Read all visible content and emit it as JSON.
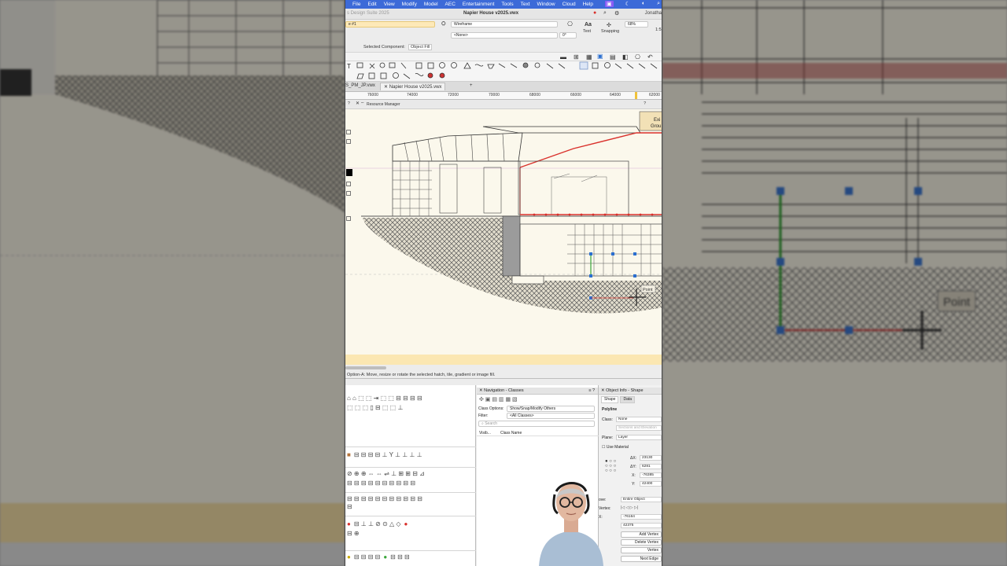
{
  "menubar": {
    "items": [
      "File",
      "Edit",
      "View",
      "Modify",
      "Model",
      "AEC",
      "Entertainment",
      "Tools",
      "Text",
      "Window",
      "Cloud",
      "Help"
    ]
  },
  "titlebar": {
    "app_name": "s Design Suite 2025",
    "document_title": "Napier House v2025.vwx",
    "user": "Jonatha"
  },
  "viewbar": {
    "layer_field": "e #1",
    "render_mode": "Wireframe",
    "class_none": "<None>",
    "rotation": "0°",
    "selected_component_label": "Selected Component:",
    "selected_component_value": "Object Fill",
    "text_label": "Text",
    "snapping_label": "Snapping",
    "zoom": "68%",
    "scale": "1:5"
  },
  "doc_tabs": {
    "tabs": [
      "S_PM_JP.vwx",
      "Napier House v2025.vwx"
    ],
    "add": "+"
  },
  "ruler": {
    "ticks": [
      "76000",
      "74000",
      "72000",
      "70000",
      "68000",
      "66000",
      "64000",
      "62000"
    ]
  },
  "resource_manager": {
    "title": "Resource Manager",
    "help": "?"
  },
  "canvas": {
    "tag_line1": "Exi",
    "tag_line2": "Grou",
    "cursor_tip": "Point"
  },
  "statusbar": {
    "text": "Option-A: Move, resize or rotate the selected hatch, tile, gradient or image fill."
  },
  "navigation": {
    "title": "Navigation - Classes",
    "class_options_label": "Class Options:",
    "class_options_value": "Show/Snap/Modify Others",
    "filter_label": "Filter:",
    "filter_value": "<All Classes>",
    "search_placeholder": "Search",
    "col_visibility": "Visib...",
    "col_class_name": "Class Name"
  },
  "object_info": {
    "title": "Object Info - Shape",
    "tab_shape": "Shape",
    "tab_data": "Data",
    "object_type": "Polyline",
    "class_label": "Class:",
    "class_value": "None",
    "layer_label": "Layer:",
    "layer_value": "Sections and Elevation",
    "plane_label": "Plane:",
    "plane_value": "Layer",
    "use_material": "Use Material",
    "dx_label": "ΔX:",
    "dx_value": "23130",
    "dy_label": "ΔY:",
    "dy_value": "6281",
    "x_label": "X:",
    "x_value": "-76385",
    "y_label": "Y:",
    "y_value": "42400",
    "move_label": "ove:",
    "move_value": "Entire Object",
    "vertex_label": "Vertex:",
    "vx_label": "X:",
    "vx_value": "-76164",
    "vy_label": "",
    "vy_value": "42375",
    "add_vertex": "Add Vertex",
    "delete_vertex": "Delete Vertex",
    "vertex_btn": "Vertex",
    "next_edge": "Next Edge"
  },
  "colors": {
    "menubar": "#3c6ad8",
    "canvas": "#fbf8ec",
    "hint": "#fbe7b2",
    "selection_red": "#d9302b",
    "vertex_blue": "#2b6fd0",
    "green_edge": "#3aa63a"
  }
}
